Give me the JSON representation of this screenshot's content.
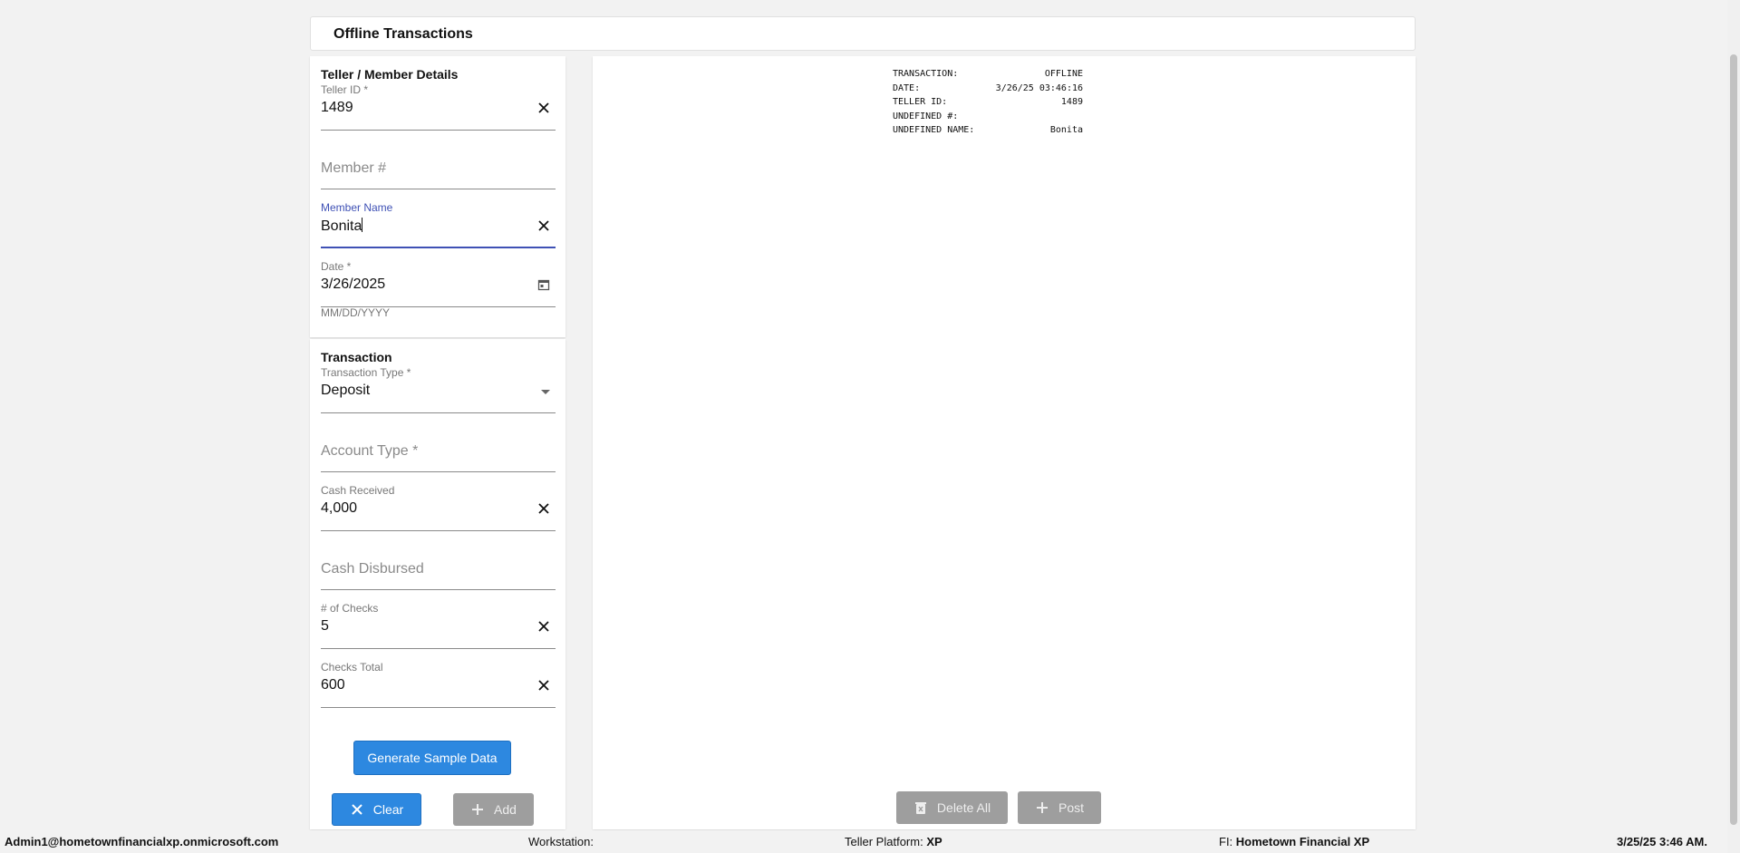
{
  "page": {
    "title": "Offline Transactions"
  },
  "teller_section": {
    "title": "Teller / Member Details",
    "teller_id": {
      "label": "Teller ID *",
      "value": "1489"
    },
    "member_number": {
      "placeholder": "Member #"
    },
    "member_name": {
      "label": "Member Name",
      "value": "Bonita"
    },
    "date": {
      "label": "Date *",
      "value": "3/26/2025",
      "hint": "MM/DD/YYYY"
    }
  },
  "transaction_section": {
    "title": "Transaction",
    "transaction_type": {
      "label": "Transaction Type *",
      "value": "Deposit"
    },
    "account_type": {
      "placeholder": "Account Type *"
    },
    "cash_received": {
      "label": "Cash Received",
      "value": "4,000"
    },
    "cash_disbursed": {
      "placeholder": "Cash Disbursed"
    },
    "num_checks": {
      "label": "# of Checks",
      "value": "5"
    },
    "checks_total": {
      "label": "Checks Total",
      "value": "600"
    }
  },
  "buttons": {
    "generate": "Generate Sample Data",
    "clear": "Clear",
    "add": "Add",
    "delete_all": "Delete All",
    "post": "Post"
  },
  "receipt": [
    {
      "key": "TRANSACTION:",
      "value": "OFFLINE"
    },
    {
      "key": "DATE:",
      "value": "3/26/25 03:46:16"
    },
    {
      "key": "TELLER ID:",
      "value": "1489"
    },
    {
      "key": "UNDEFINED #:",
      "value": ""
    },
    {
      "key": "UNDEFINED NAME:",
      "value": "Bonita"
    }
  ],
  "footer": {
    "user": "Admin1@hometownfinancialxp.onmicrosoft.com",
    "workstation_label": "Workstation:",
    "workstation_value": "",
    "platform_label": "Teller Platform:",
    "platform_value": "XP",
    "fi_label": "FI:",
    "fi_value": "Hometown Financial XP",
    "datetime": "3/25/25 3:46 AM."
  },
  "colors": {
    "accent": "#2d88e0",
    "focus": "#3f51b5",
    "disabled": "#9e9e9e"
  }
}
